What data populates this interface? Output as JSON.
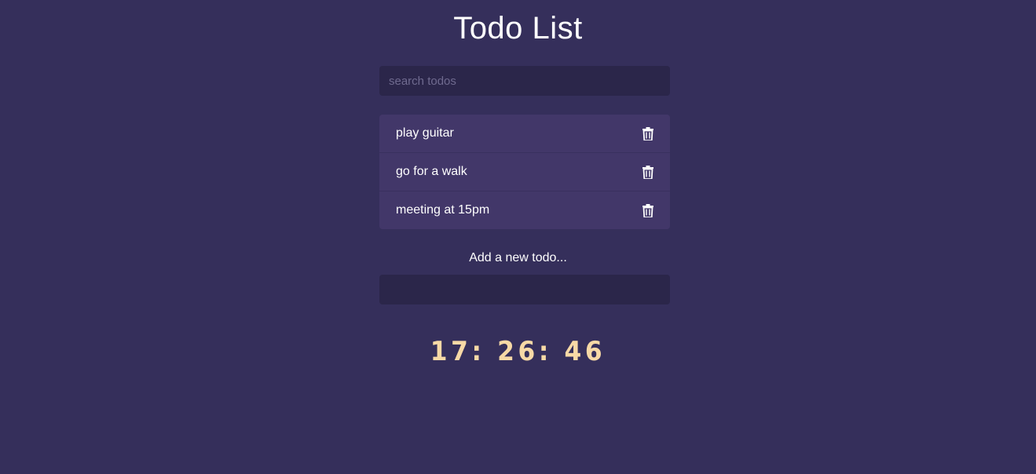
{
  "title": "Todo List",
  "search": {
    "placeholder": "search todos",
    "value": ""
  },
  "todos": [
    {
      "text": "play guitar",
      "icon": "trash-icon"
    },
    {
      "text": "go for a walk",
      "icon": "trash-icon"
    },
    {
      "text": "meeting at 15pm",
      "icon": "trash-icon"
    }
  ],
  "add": {
    "label": "Add a new todo...",
    "value": ""
  },
  "clock": "17: 26: 46",
  "colors": {
    "background": "#352f5b",
    "input_bg": "#2b264a",
    "item_bg": "#423769",
    "clock": "#f7d9a6"
  }
}
